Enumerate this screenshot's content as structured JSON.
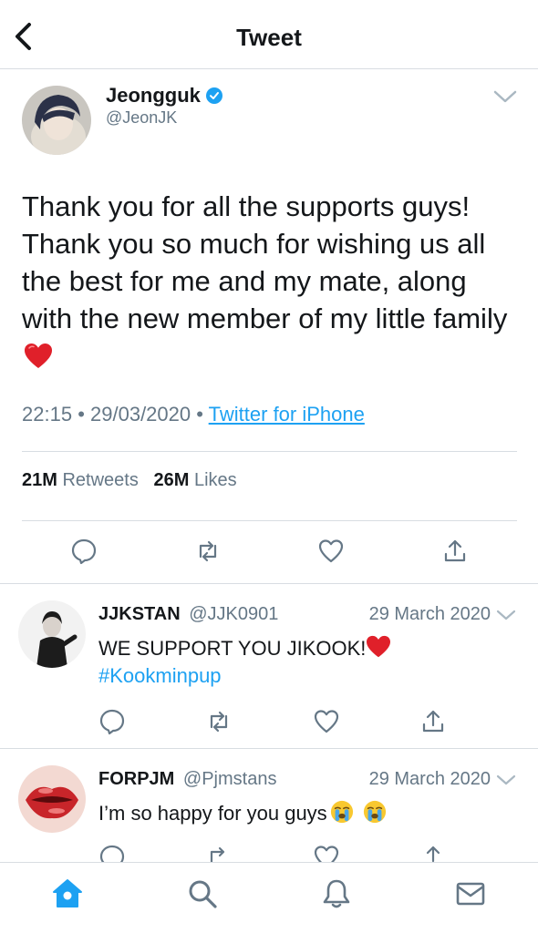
{
  "header": {
    "title": "Tweet"
  },
  "tweet": {
    "author_name": "Jeongguk",
    "author_handle": "@JeonJK",
    "text": "Thank you for all the supports guys! Thank you so much for wishing us all the best for me and my mate, along with the new member of my little family",
    "text_emoji": "heart",
    "time": "22:15",
    "date": "29/03/2020",
    "source": "Twitter for iPhone",
    "retweets_count": "21M",
    "retweets_label": "Retweets",
    "likes_count": "26M",
    "likes_label": "Likes"
  },
  "replies": [
    {
      "name": "JJKSTAN",
      "handle": "@JJK0901",
      "date": "29 March 2020",
      "text": "WE SUPPORT YOU JIKOOK!",
      "hashtag": "#Kookminpup"
    },
    {
      "name": "FORPJM",
      "handle": "@Pjmstans",
      "date": "29 March 2020",
      "text": "I’m so happy for you guys"
    }
  ],
  "tabbar": {
    "items": [
      "home-icon",
      "search-icon",
      "notifications-icon",
      "messages-icon"
    ]
  },
  "colors": {
    "accent": "#1da1f2",
    "muted": "#657786",
    "text": "#14171a",
    "divider": "#d8dde2"
  }
}
